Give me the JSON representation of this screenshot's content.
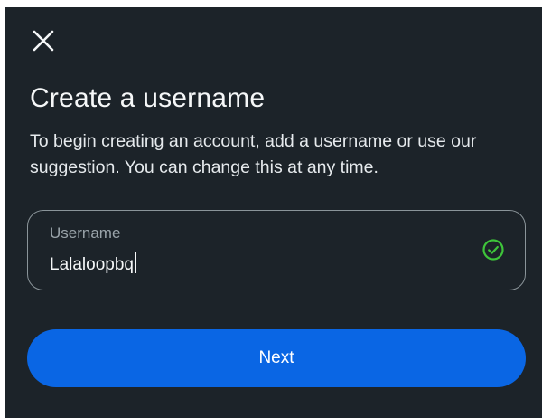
{
  "header": {
    "close_icon": "close-icon"
  },
  "title": "Create a username",
  "description": "To begin creating an account, add a username or use our suggestion. You can change this at any time.",
  "username_field": {
    "label": "Username",
    "value": "Lalaloopbq",
    "status_icon": "check-circle-icon",
    "status_color": "#3ec43a"
  },
  "next_button": {
    "label": "Next",
    "color": "#0a66e4"
  },
  "colors": {
    "background": "#1c2329",
    "text": "#f5f7f8"
  }
}
